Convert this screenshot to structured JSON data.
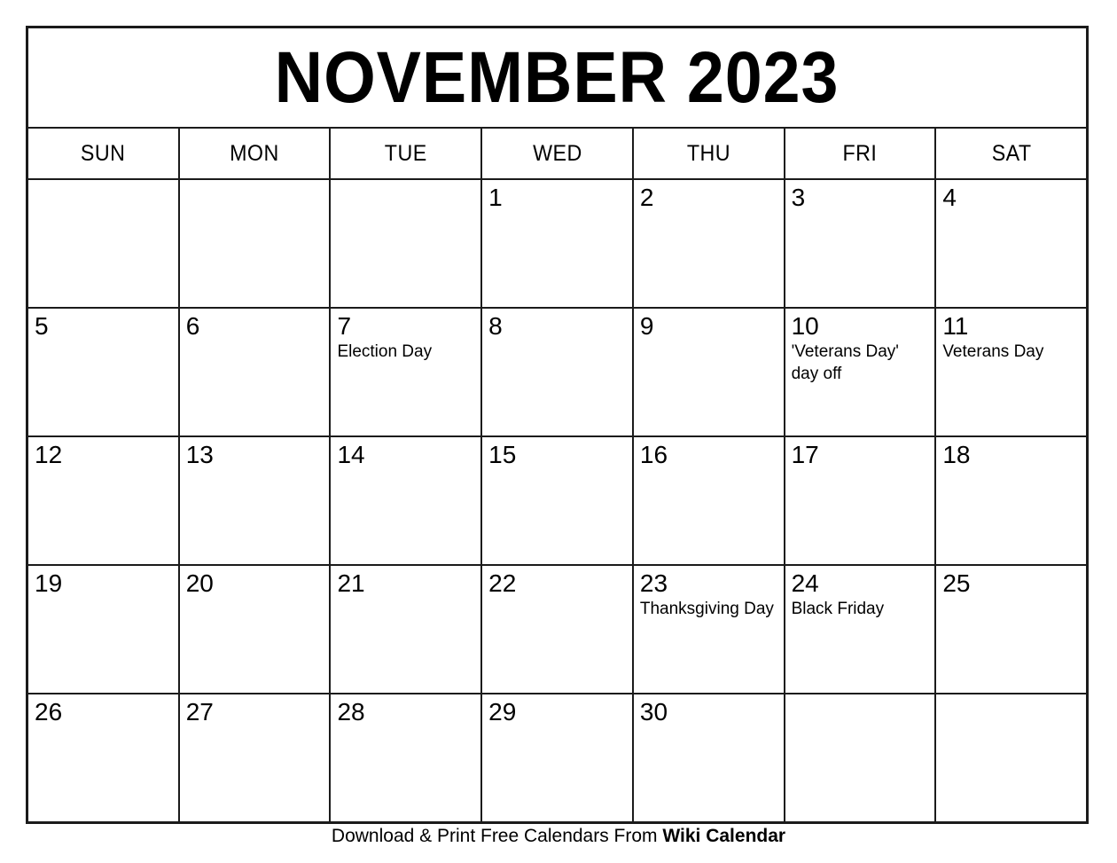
{
  "title": "NOVEMBER 2023",
  "weekdays": [
    "SUN",
    "MON",
    "TUE",
    "WED",
    "THU",
    "FRI",
    "SAT"
  ],
  "weeks": [
    [
      {
        "day": "",
        "event": ""
      },
      {
        "day": "",
        "event": ""
      },
      {
        "day": "",
        "event": ""
      },
      {
        "day": "1",
        "event": ""
      },
      {
        "day": "2",
        "event": ""
      },
      {
        "day": "3",
        "event": ""
      },
      {
        "day": "4",
        "event": ""
      }
    ],
    [
      {
        "day": "5",
        "event": ""
      },
      {
        "day": "6",
        "event": ""
      },
      {
        "day": "7",
        "event": "Election Day"
      },
      {
        "day": "8",
        "event": ""
      },
      {
        "day": "9",
        "event": ""
      },
      {
        "day": "10",
        "event": "'Veterans Day' day off"
      },
      {
        "day": "11",
        "event": "Veterans Day"
      }
    ],
    [
      {
        "day": "12",
        "event": ""
      },
      {
        "day": "13",
        "event": ""
      },
      {
        "day": "14",
        "event": ""
      },
      {
        "day": "15",
        "event": ""
      },
      {
        "day": "16",
        "event": ""
      },
      {
        "day": "17",
        "event": ""
      },
      {
        "day": "18",
        "event": ""
      }
    ],
    [
      {
        "day": "19",
        "event": ""
      },
      {
        "day": "20",
        "event": ""
      },
      {
        "day": "21",
        "event": ""
      },
      {
        "day": "22",
        "event": ""
      },
      {
        "day": "23",
        "event": "Thanksgiving Day"
      },
      {
        "day": "24",
        "event": "Black Friday"
      },
      {
        "day": "25",
        "event": ""
      }
    ],
    [
      {
        "day": "26",
        "event": ""
      },
      {
        "day": "27",
        "event": ""
      },
      {
        "day": "28",
        "event": ""
      },
      {
        "day": "29",
        "event": ""
      },
      {
        "day": "30",
        "event": ""
      },
      {
        "day": "",
        "event": ""
      },
      {
        "day": "",
        "event": ""
      }
    ]
  ],
  "footer": {
    "text": "Download & Print Free Calendars From ",
    "brand": "Wiki Calendar"
  },
  "colors": {
    "border": "#1b1b1b",
    "background": "#ffffff",
    "text": "#000000"
  }
}
